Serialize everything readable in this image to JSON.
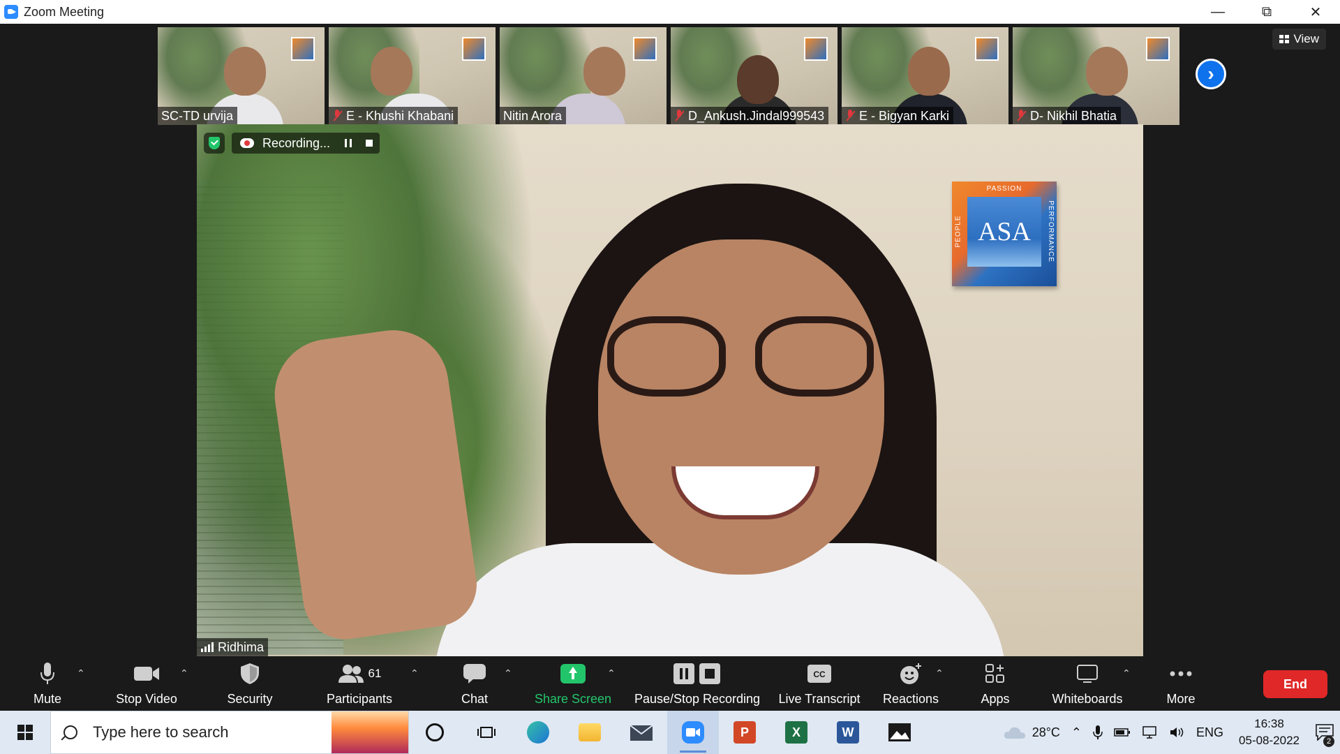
{
  "window": {
    "title": "Zoom Meeting",
    "controls": [
      "minimize",
      "restore",
      "close"
    ]
  },
  "gallery_strip": {
    "participants": [
      {
        "name": "SC-TD urvija",
        "muted": false
      },
      {
        "name": "E - Khushi Khabani",
        "muted": true
      },
      {
        "name": "Nitin Arora",
        "muted": false
      },
      {
        "name": "D_Ankush.Jindal999543",
        "muted": true
      },
      {
        "name": "E - Bigyan Karki",
        "muted": true
      },
      {
        "name": "D- Nikhil Bhatia",
        "muted": true
      }
    ],
    "next_icon": "chevron-right-icon"
  },
  "view_button": {
    "label": "View"
  },
  "recording": {
    "label": "Recording..."
  },
  "speaker": {
    "name": "Ridhima",
    "logo": {
      "main": "ASA",
      "top": "PASSION",
      "left": "PEOPLE",
      "right": "PERFORMANCE"
    }
  },
  "toolbar": {
    "items": [
      {
        "key": "mute",
        "label": "Mute",
        "icon": "microphone-icon"
      },
      {
        "key": "video",
        "label": "Stop Video",
        "icon": "video-camera-icon"
      },
      {
        "key": "security",
        "label": "Security",
        "icon": "shield-icon"
      },
      {
        "key": "participants",
        "label": "Participants",
        "icon": "people-icon",
        "count": "61"
      },
      {
        "key": "chat",
        "label": "Chat",
        "icon": "chat-bubble-icon"
      },
      {
        "key": "share",
        "label": "Share Screen",
        "icon": "share-screen-icon",
        "color": "#23c56b"
      },
      {
        "key": "recording",
        "label": "Pause/Stop Recording",
        "icon": "pause-stop-icon"
      },
      {
        "key": "transcript",
        "label": "Live Transcript",
        "icon": "cc-icon"
      },
      {
        "key": "reactions",
        "label": "Reactions",
        "icon": "smiley-icon"
      },
      {
        "key": "apps",
        "label": "Apps",
        "icon": "apps-icon"
      },
      {
        "key": "whiteboards",
        "label": "Whiteboards",
        "icon": "whiteboard-icon"
      },
      {
        "key": "more",
        "label": "More",
        "icon": "more-dots-icon"
      }
    ],
    "end_label": "End",
    "end_color": "#e02828"
  },
  "taskbar": {
    "search_placeholder": "Type here to search",
    "apps": [
      "cortana-icon",
      "task-view-icon",
      "edge-icon",
      "file-explorer-icon",
      "mail-icon",
      "zoom-icon",
      "powerpoint-icon",
      "excel-icon",
      "word-icon",
      "photos-icon"
    ],
    "weather": "28°C",
    "language": "ENG",
    "time": "16:38",
    "date": "05-08-2022",
    "notifications": "2"
  }
}
